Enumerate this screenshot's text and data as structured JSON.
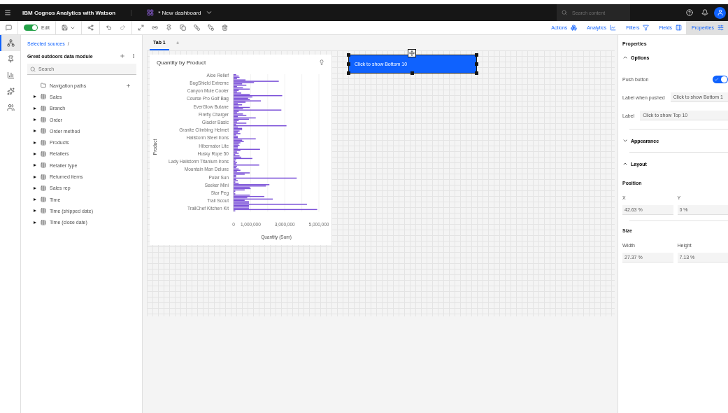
{
  "top_bar": {
    "product": "IBM Cognos Analytics with Watson",
    "dashboard": "* New dashboard",
    "search": {
      "placeholder": "Search content"
    }
  },
  "toolbar": {
    "edit": {
      "label": "Edit",
      "on": true
    },
    "panels": [
      {
        "label": "Actions",
        "kind": "actions",
        "selected": false
      },
      {
        "label": "Analytics",
        "kind": "analytics",
        "selected": false
      },
      {
        "label": "Filters",
        "kind": "filters",
        "selected": false
      },
      {
        "label": "Fields",
        "kind": "fields",
        "selected": false
      },
      {
        "label": "Properties",
        "kind": "properties",
        "selected": true
      }
    ]
  },
  "rail": [
    {
      "kind": "sources",
      "selected": true
    },
    {
      "kind": "pin",
      "selected": false
    },
    {
      "kind": "visualizations",
      "selected": false
    },
    {
      "kind": "insights",
      "selected": false
    },
    {
      "kind": "people",
      "selected": false
    }
  ],
  "sidebar": {
    "breadcrumb": "Selected sources",
    "separator": "/",
    "module": "Great outdoors data module",
    "search": {
      "placeholder": "Search"
    },
    "items": [
      {
        "label": "Navigation paths",
        "kind": "folder"
      },
      {
        "label": "Sales",
        "kind": "table",
        "expanded": false
      },
      {
        "label": "Branch",
        "kind": "table",
        "expanded": false
      },
      {
        "label": "Order",
        "kind": "table",
        "expanded": false
      },
      {
        "label": "Order method",
        "kind": "table",
        "expanded": false
      },
      {
        "label": "Products",
        "kind": "table",
        "expanded": false
      },
      {
        "label": "Retailers",
        "kind": "table",
        "expanded": false
      },
      {
        "label": "Retailer type",
        "kind": "table",
        "expanded": false
      },
      {
        "label": "Returned items",
        "kind": "table",
        "expanded": false
      },
      {
        "label": "Sales rep",
        "kind": "table",
        "expanded": false
      },
      {
        "label": "Time",
        "kind": "table",
        "expanded": false
      },
      {
        "label": "Time (shipped date)",
        "kind": "table",
        "expanded": false
      },
      {
        "label": "Time (close date)",
        "kind": "table",
        "expanded": false
      }
    ]
  },
  "tabs": [
    {
      "label": "Tab 1",
      "selected": true
    }
  ],
  "add_tab": "+",
  "chart": {
    "title": "Quantity by Product",
    "chart_data": {
      "type": "bar",
      "orientation": "horizontal",
      "xlabel": "Quantity (Sum)",
      "ylabel": "Product",
      "xlim": [
        0,
        5000000
      ],
      "xticks": [
        {
          "value": 0,
          "label": "0"
        },
        {
          "value": 1000000,
          "label": "1,000,000"
        },
        {
          "value": 3000000,
          "label": "3,000,000"
        },
        {
          "value": 5000000,
          "label": "5,000,000"
        }
      ],
      "categories": [
        "Aloe Relief",
        null,
        null,
        null,
        null,
        null,
        "BugShield Extreme",
        null,
        null,
        null,
        null,
        null,
        "Canyon Mule Cooler",
        null,
        null,
        null,
        null,
        null,
        "Course Pro Golf Bag",
        null,
        null,
        null,
        null,
        null,
        "EverGlow Butane",
        null,
        null,
        null,
        null,
        null,
        "Firefly Charger",
        null,
        null,
        null,
        null,
        null,
        "Glacier Basic",
        null,
        null,
        null,
        null,
        null,
        "Granite Climbing Helmet",
        null,
        null,
        null,
        null,
        null,
        "Hailstorm Steel Irons",
        null,
        null,
        null,
        null,
        null,
        "Hibernator Lite",
        null,
        null,
        null,
        null,
        null,
        "Husky Rope 50",
        null,
        null,
        null,
        null,
        null,
        "Lady Hailstorm Titanium Irons",
        null,
        null,
        null,
        null,
        null,
        "Mountain Man Deluxe",
        null,
        null,
        null,
        null,
        null,
        "Polar Sun",
        null,
        null,
        null,
        null,
        null,
        "Seeker Mini",
        null,
        null,
        null,
        null,
        null,
        "Star Peg",
        null,
        null,
        null,
        null,
        null,
        "Trail Scout",
        null,
        null,
        null,
        null,
        null,
        "TrailChef Kitchen Kit",
        null,
        null
      ],
      "series": [
        {
          "color": "#7a4fd8",
          "values": [
            150000,
            300000,
            350000,
            200000,
            700000,
            2650000,
            1200000,
            500000,
            750000,
            200000,
            550000,
            950000,
            300000,
            200000,
            450000,
            950000,
            2850000,
            1100000,
            850000,
            950000,
            1600000,
            700000,
            250000,
            500000,
            300000,
            950000,
            550000,
            2800000,
            300000,
            200000,
            550000,
            750000,
            250000,
            1300000,
            900000,
            300000,
            200000,
            750000,
            150000,
            3100000,
            250000,
            500000,
            500000,
            350000,
            250000,
            400000,
            150000,
            250000,
            250000,
            1300000,
            500000,
            600000,
            400000,
            300000,
            350000,
            250000,
            250000,
            1550000,
            400000,
            200000,
            300000,
            100000,
            350000,
            450000,
            1100000,
            150000,
            100000,
            200000,
            150000,
            1500000,
            200000,
            150000,
            300000,
            400000,
            200000,
            950000,
            650000,
            150000,
            150000,
            3700000,
            150000,
            250000,
            100000,
            300000,
            2100000,
            1900000,
            950000,
            1000000,
            650000,
            100000,
            50000,
            100000,
            950000,
            1800000,
            800000,
            2300000,
            650000,
            900000,
            900000,
            4300000,
            900000,
            900000,
            900000,
            4900000,
            100000
          ]
        }
      ]
    }
  },
  "widget_button": {
    "label": "Click to show Bottom 10"
  },
  "properties": {
    "title": "Properties",
    "sections": [
      {
        "title": "Options",
        "expanded": true,
        "push_button": {
          "label": "Push button",
          "on": true
        },
        "fields": [
          {
            "label": "Label when pushed",
            "value": "Click to show Bottom 1"
          },
          {
            "label": "Label",
            "value": "Click to show Top 10"
          }
        ]
      },
      {
        "title": "Appearance",
        "expanded": false
      },
      {
        "title": "Layout",
        "expanded": true,
        "groups": [
          {
            "title": "Position",
            "fields": [
              {
                "label": "X",
                "value": "42.63 %"
              },
              {
                "label": "Y",
                "value": "0 %"
              }
            ]
          },
          {
            "title": "Size",
            "fields": [
              {
                "label": "Width",
                "value": "27.37 %"
              },
              {
                "label": "Height",
                "value": "7.13 %"
              }
            ]
          }
        ]
      }
    ]
  }
}
